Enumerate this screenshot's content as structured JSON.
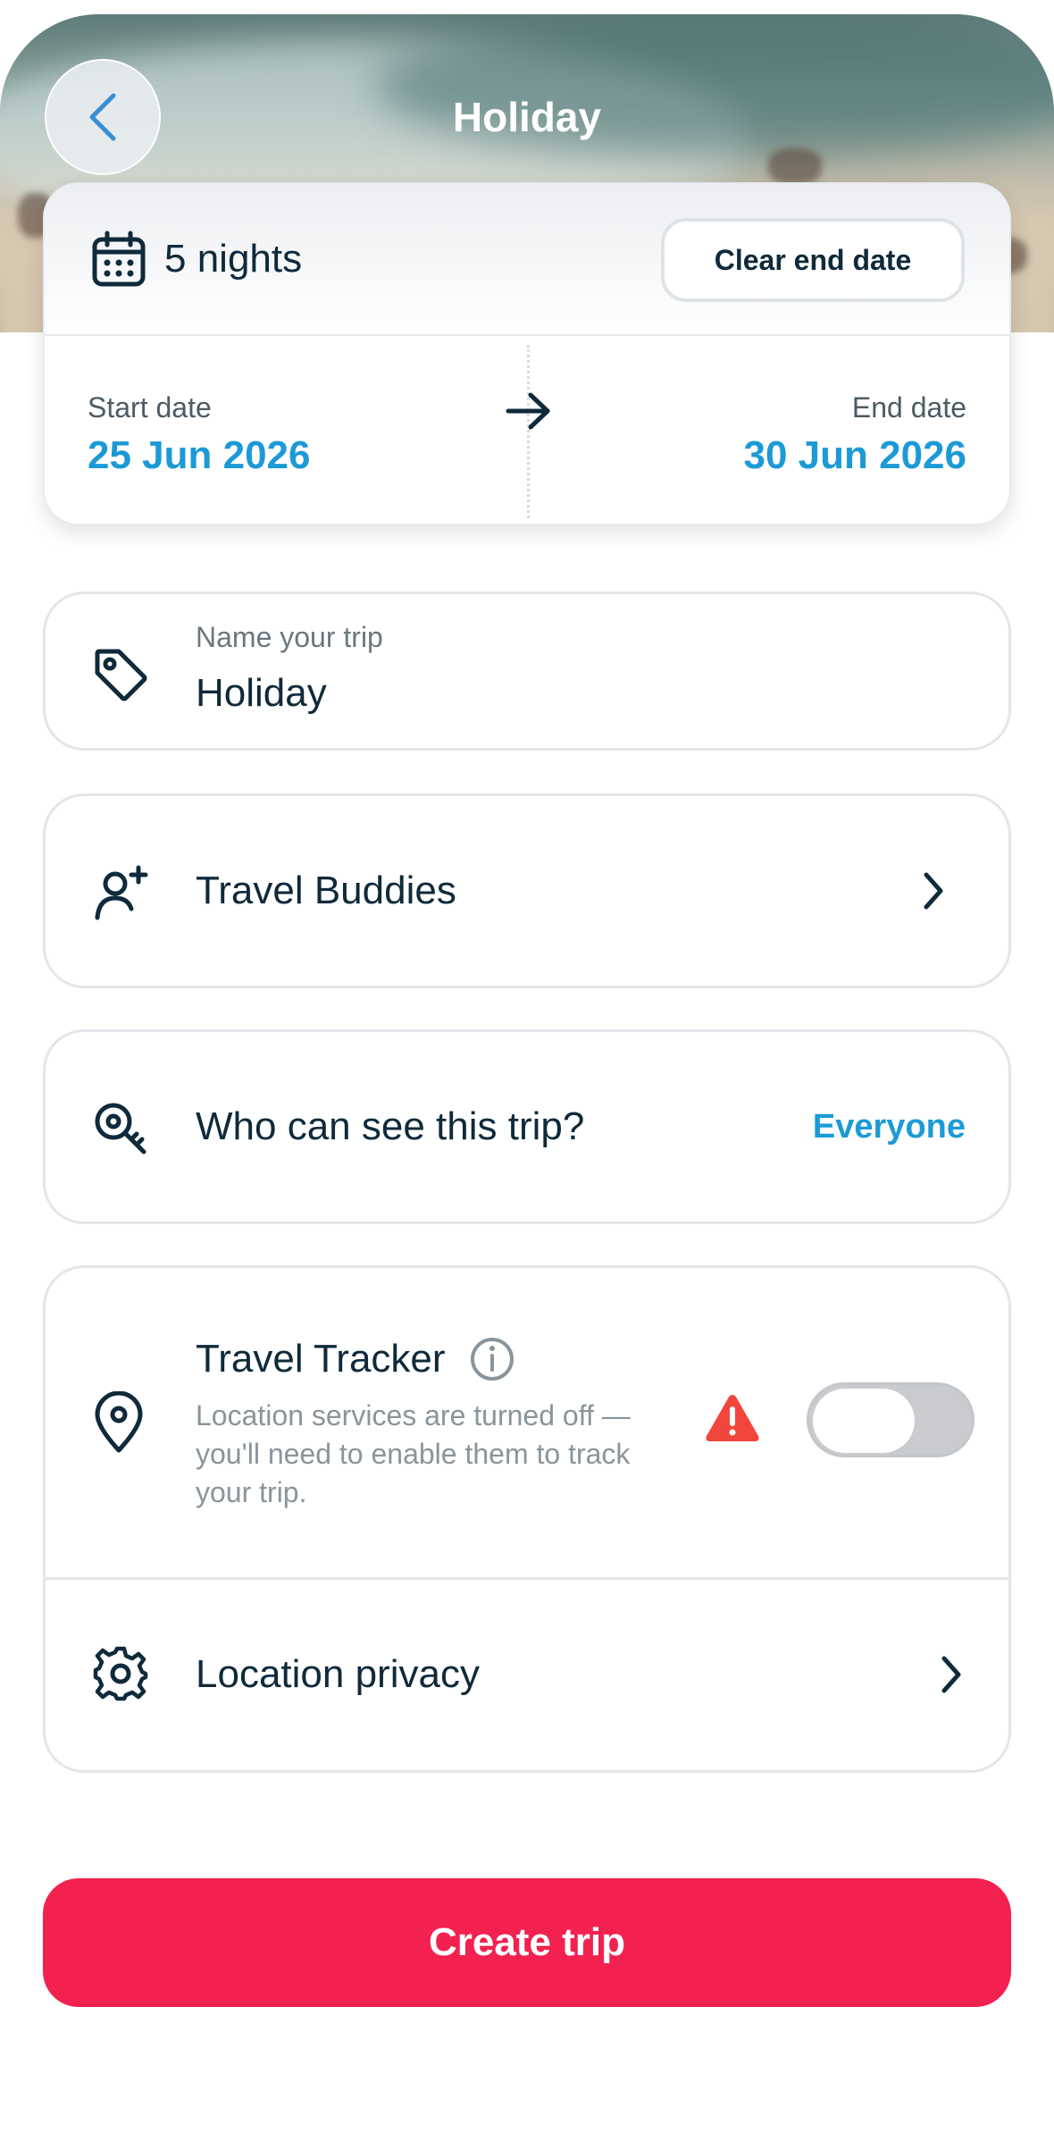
{
  "header": {
    "title": "Holiday",
    "back_icon": "chevron-left-icon"
  },
  "dates": {
    "nights_label": "5 nights",
    "clear_label": "Clear end date",
    "start_label": "Start date",
    "start_value": "25 Jun 2026",
    "end_label": "End date",
    "end_value": "30 Jun 2026"
  },
  "name_field": {
    "label": "Name your trip",
    "value": "Holiday"
  },
  "buddies": {
    "label": "Travel Buddies"
  },
  "visibility": {
    "label": "Who can see this trip?",
    "value": "Everyone"
  },
  "tracker": {
    "title": "Travel Tracker",
    "description": "Location services are turned off — you'll need to enable them to track your trip.",
    "toggle_on": false
  },
  "privacy": {
    "label": "Location privacy"
  },
  "actions": {
    "create_label": "Create trip"
  },
  "colors": {
    "accent_blue": "#1c9ad6",
    "primary_button": "#f2214f",
    "warning": "#f2463c",
    "text_dark": "#0f2a3a"
  }
}
